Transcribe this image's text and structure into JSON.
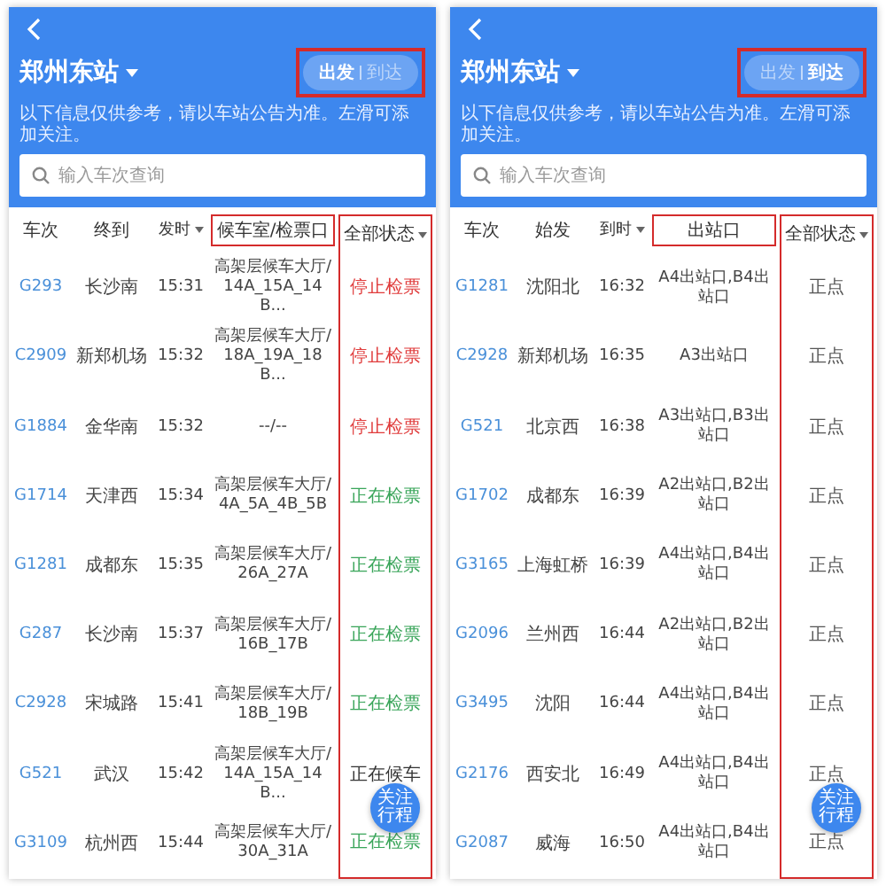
{
  "panels": [
    {
      "station": "郑州东站",
      "toggle": {
        "highlighted": true,
        "options": [
          {
            "label": "出发",
            "selected": true
          },
          {
            "label": "到达",
            "selected": false
          }
        ]
      },
      "notice": "以下信息仅供参考，请以车站公告为准。左滑可添加关注。",
      "search": {
        "placeholder": "输入车次查询"
      },
      "columns": [
        {
          "label": "车次",
          "sortable": false,
          "highlighted": false
        },
        {
          "label": "终到",
          "sortable": false,
          "highlighted": false
        },
        {
          "label": "发时",
          "sortable": true,
          "highlighted": false
        },
        {
          "label": "候车室/检票口",
          "sortable": false,
          "highlighted": true
        },
        {
          "label": "全部状态",
          "sortable": true,
          "highlighted": true
        }
      ],
      "rows": [
        {
          "train": "G293",
          "station": "长沙南",
          "time": "15:31",
          "gate": "高架层候车大厅/14A_15A_14B...",
          "status": "停止检票",
          "kind": "stopped"
        },
        {
          "train": "C2909",
          "station": "新郑机场",
          "time": "15:32",
          "gate": "高架层候车大厅/18A_19A_18B...",
          "status": "停止检票",
          "kind": "stopped"
        },
        {
          "train": "G1884",
          "station": "金华南",
          "time": "15:32",
          "gate": "--/--",
          "status": "停止检票",
          "kind": "stopped"
        },
        {
          "train": "G1714",
          "station": "天津西",
          "time": "15:34",
          "gate": "高架层候车大厅/4A_5A_4B_5B",
          "status": "正在检票",
          "kind": "checking"
        },
        {
          "train": "G1281",
          "station": "成都东",
          "time": "15:35",
          "gate": "高架层候车大厅/26A_27A",
          "status": "正在检票",
          "kind": "checking"
        },
        {
          "train": "G287",
          "station": "长沙南",
          "time": "15:37",
          "gate": "高架层候车大厅/16B_17B",
          "status": "正在检票",
          "kind": "checking"
        },
        {
          "train": "C2928",
          "station": "宋城路",
          "time": "15:41",
          "gate": "高架层候车大厅/18B_19B",
          "status": "正在检票",
          "kind": "checking"
        },
        {
          "train": "G521",
          "station": "武汉",
          "time": "15:42",
          "gate": "高架层候车大厅/14A_15A_14B...",
          "status": "正在候车",
          "kind": "waiting"
        },
        {
          "train": "G3109",
          "station": "杭州西",
          "time": "15:44",
          "gate": "高架层候车大厅/30A_31A",
          "status": "正在检票",
          "kind": "checking"
        }
      ],
      "follow_button": "关注行程"
    },
    {
      "station": "郑州东站",
      "toggle": {
        "highlighted": true,
        "options": [
          {
            "label": "出发",
            "selected": false
          },
          {
            "label": "到达",
            "selected": true
          }
        ]
      },
      "notice": "以下信息仅供参考，请以车站公告为准。左滑可添加关注。",
      "search": {
        "placeholder": "输入车次查询"
      },
      "columns": [
        {
          "label": "车次",
          "sortable": false,
          "highlighted": false
        },
        {
          "label": "始发",
          "sortable": false,
          "highlighted": false
        },
        {
          "label": "到时",
          "sortable": true,
          "highlighted": false
        },
        {
          "label": "出站口",
          "sortable": false,
          "highlighted": true
        },
        {
          "label": "全部状态",
          "sortable": true,
          "highlighted": true
        }
      ],
      "rows": [
        {
          "train": "G1281",
          "station": "沈阳北",
          "time": "16:32",
          "gate": "A4出站口,B4出站口",
          "status": "正点",
          "kind": "on_time"
        },
        {
          "train": "C2928",
          "station": "新郑机场",
          "time": "16:35",
          "gate": "A3出站口",
          "status": "正点",
          "kind": "on_time"
        },
        {
          "train": "G521",
          "station": "北京西",
          "time": "16:38",
          "gate": "A3出站口,B3出站口",
          "status": "正点",
          "kind": "on_time"
        },
        {
          "train": "G1702",
          "station": "成都东",
          "time": "16:39",
          "gate": "A2出站口,B2出站口",
          "status": "正点",
          "kind": "on_time"
        },
        {
          "train": "G3165",
          "station": "上海虹桥",
          "time": "16:39",
          "gate": "A4出站口,B4出站口",
          "status": "正点",
          "kind": "on_time"
        },
        {
          "train": "G2096",
          "station": "兰州西",
          "time": "16:44",
          "gate": "A2出站口,B2出站口",
          "status": "正点",
          "kind": "on_time"
        },
        {
          "train": "G3495",
          "station": "沈阳",
          "time": "16:44",
          "gate": "A4出站口,B4出站口",
          "status": "正点",
          "kind": "on_time"
        },
        {
          "train": "G2176",
          "station": "西安北",
          "time": "16:49",
          "gate": "A4出站口,B4出站口",
          "status": "正点",
          "kind": "on_time"
        },
        {
          "train": "G2087",
          "station": "威海",
          "time": "16:50",
          "gate": "A4出站口,B4出站口",
          "status": "正点",
          "kind": "on_time"
        }
      ],
      "follow_button": "关注行程"
    }
  ]
}
